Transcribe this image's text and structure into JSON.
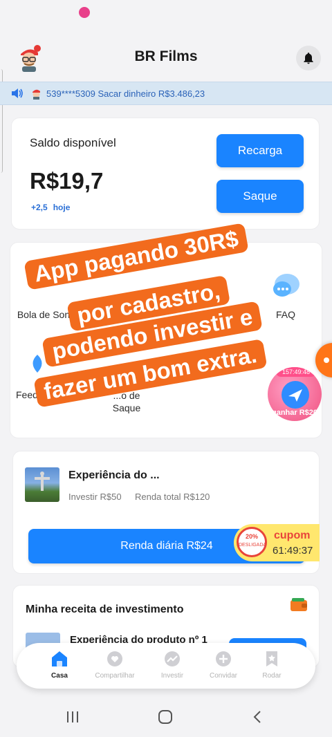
{
  "header": {
    "title": "BR Films"
  },
  "ticker": {
    "text": "539****5309 Sacar dinheiro R$3.486,23"
  },
  "balance": {
    "label": "Saldo disponível",
    "value": "R$19,7",
    "change": "+2,5",
    "change_period": "hoje",
    "recharge_label": "Recarga",
    "withdraw_label": "Saque"
  },
  "menu": {
    "items": [
      {
        "label": "Bola de Son"
      },
      {
        "label": "FAQ"
      },
      {
        "label": "Feed-"
      },
      {
        "label": "...o de\nSaque"
      }
    ],
    "promo_timer": "157:49:48",
    "promo_label": "ganhar R$20"
  },
  "overlay": {
    "lines": [
      "App pagando 30R$",
      "por cadastro,",
      "podendo investir e",
      "fazer um bom extra."
    ]
  },
  "investment": {
    "title": "Experiência do ...",
    "invest": "Investir R$50",
    "total": "Renda total R$120",
    "daily_button": "Renda diária R$24"
  },
  "coupon": {
    "percent": "20%",
    "status": "DESLIGADA",
    "title": "cupom",
    "countdown": "61:49:37"
  },
  "income": {
    "title": "Minha receita de investimento",
    "item_title": "Experiência do produto nº 1"
  },
  "nav": {
    "items": [
      {
        "label": "Casa"
      },
      {
        "label": "Compartilhar"
      },
      {
        "label": "Investir"
      },
      {
        "label": "Convidar"
      },
      {
        "label": "Rodar"
      }
    ]
  },
  "colors": {
    "accent": "#1a84ff",
    "overlay": "#f26b1d",
    "coupon": "#ffe76e",
    "ticker_bg": "#d7e6f3"
  }
}
